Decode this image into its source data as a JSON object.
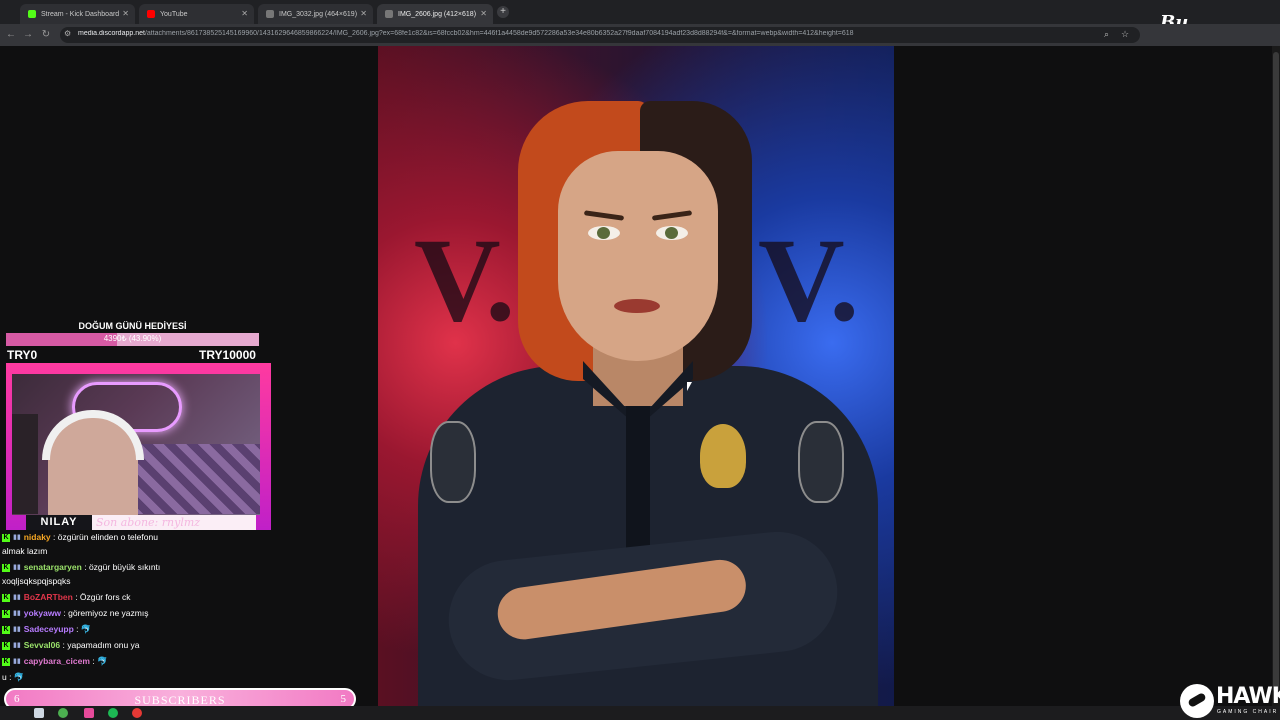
{
  "browser": {
    "tabs": [
      {
        "label": "Stream - Kick Dashboard",
        "color": "#53fc18"
      },
      {
        "label": "YouTube",
        "color": "#ff0000"
      },
      {
        "label": "IMG_3032.jpg (464×619)",
        "color": "#9aa0a6"
      },
      {
        "label": "IMG_2606.jpg (412×618)",
        "color": "#9aa0a6"
      }
    ],
    "url_host": "media.discordapp.net",
    "url_path": "/attachments/861738525145169960/1431629646859866224/IMG_2606.jpg?ex=68fe1c82&is=68fccb02&hm=446f1a4458de9d572286a53e34e80b6352a27f9daaf7084194adf23d8d88294f&=&format=webp&width=412&height=618"
  },
  "image": {
    "letters_left": "V.",
    "letters_right": "V."
  },
  "goal": {
    "title": "DOĞUM GÜNÜ HEDİYESİ",
    "progress_text": "4390₺ (43.90%)",
    "progress_fraction": 0.439,
    "min_label": "TRY0",
    "max_label": "TRY10000"
  },
  "webcam": {
    "streamer_name": "NILAY",
    "last_sub_text": "Son abone: rnylmz"
  },
  "chat": {
    "messages": [
      {
        "user": "nidaky",
        "user_color": "#f5a623",
        "text": ": özgürün elinden o telefonu"
      },
      {
        "user": "",
        "user_color": "#ffffff",
        "text": "almak lazım"
      },
      {
        "user": "senatargaryen",
        "user_color": "#9be36b",
        "text": ": özgür büyük sıkıntı"
      },
      {
        "user": "",
        "user_color": "#ffffff",
        "text": "xoqljsqkspqjspqks"
      },
      {
        "user": "BoZARTben",
        "user_color": "#e0364a",
        "text": ": Özgür fors ck"
      },
      {
        "user": "yokyaww",
        "user_color": "#b77cff",
        "text": ": göremiyoz ne yazmış"
      },
      {
        "user": "Sadeceyupp",
        "user_color": "#b77cff",
        "text": ": 🐬"
      },
      {
        "user": "Sevval06",
        "user_color": "#9be36b",
        "text": ": yapamadım onu ya"
      },
      {
        "user": "capybara_cicem",
        "user_color": "#e07ad0",
        "text": ": 🐬"
      },
      {
        "user": "",
        "user_color": "#ffffff",
        "text": "u : 🐬"
      }
    ]
  },
  "subscribers": {
    "left": "6",
    "label": "SUBSCRIBERS",
    "right": "5"
  },
  "brand": {
    "name": "HAWK",
    "sub": "GAMING CHAIR",
    "corner": "Bu"
  },
  "icons": {
    "back": "arrow-left-icon",
    "forward": "arrow-right-icon",
    "reload": "reload-icon",
    "search": "search-icon",
    "star": "star-icon"
  }
}
